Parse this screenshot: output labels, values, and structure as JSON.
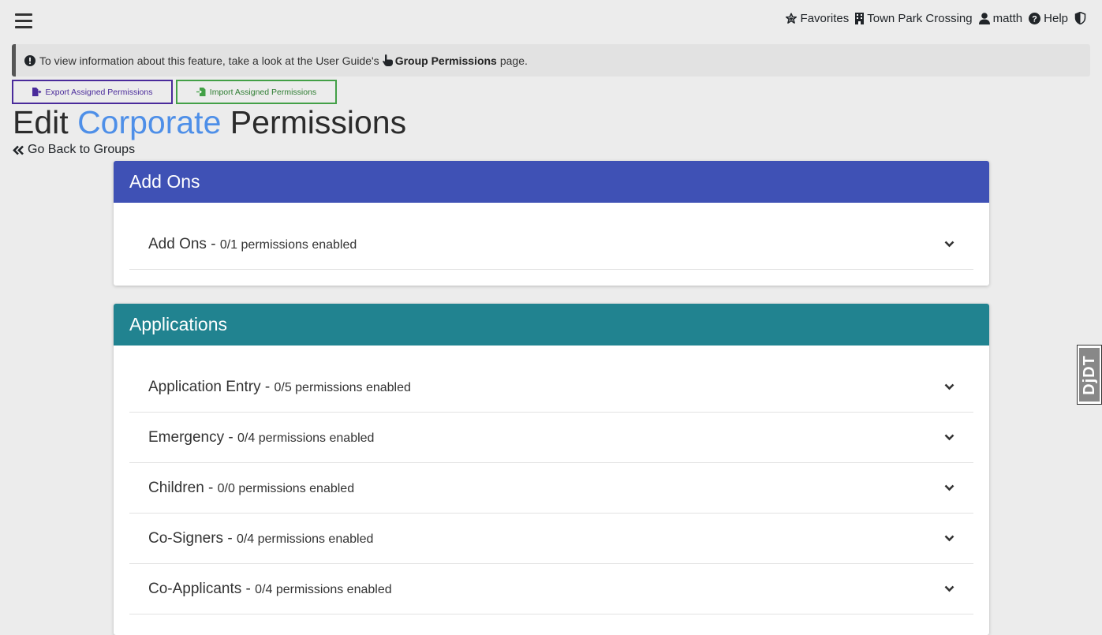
{
  "nav": {
    "favorites": "Favorites",
    "property": "Town Park Crossing",
    "user": "matth",
    "help": "Help"
  },
  "alert": {
    "prefix": "To view information about this feature, take a look at the User Guide's",
    "link": "Group Permissions",
    "suffix": "page."
  },
  "buttons": {
    "export": "Export Assigned Permissions",
    "import": "Import Assigned Permissions"
  },
  "title": {
    "prefix": "Edit",
    "group": "Corporate",
    "suffix": "Permissions"
  },
  "back_link": "Go Back to Groups",
  "sections": [
    {
      "header": "Add Ons",
      "color": "#3f51b5",
      "rows": [
        {
          "name": "Add Ons",
          "count": "0/1 permissions enabled"
        }
      ]
    },
    {
      "header": "Applications",
      "color": "#218390",
      "rows": [
        {
          "name": "Application Entry",
          "count": "0/5 permissions enabled"
        },
        {
          "name": "Emergency",
          "count": "0/4 permissions enabled"
        },
        {
          "name": "Children",
          "count": "0/0 permissions enabled"
        },
        {
          "name": "Co-Signers",
          "count": "0/4 permissions enabled"
        },
        {
          "name": "Co-Applicants",
          "count": "0/4 permissions enabled"
        }
      ]
    }
  ],
  "debug_toolbar": "DjDT"
}
